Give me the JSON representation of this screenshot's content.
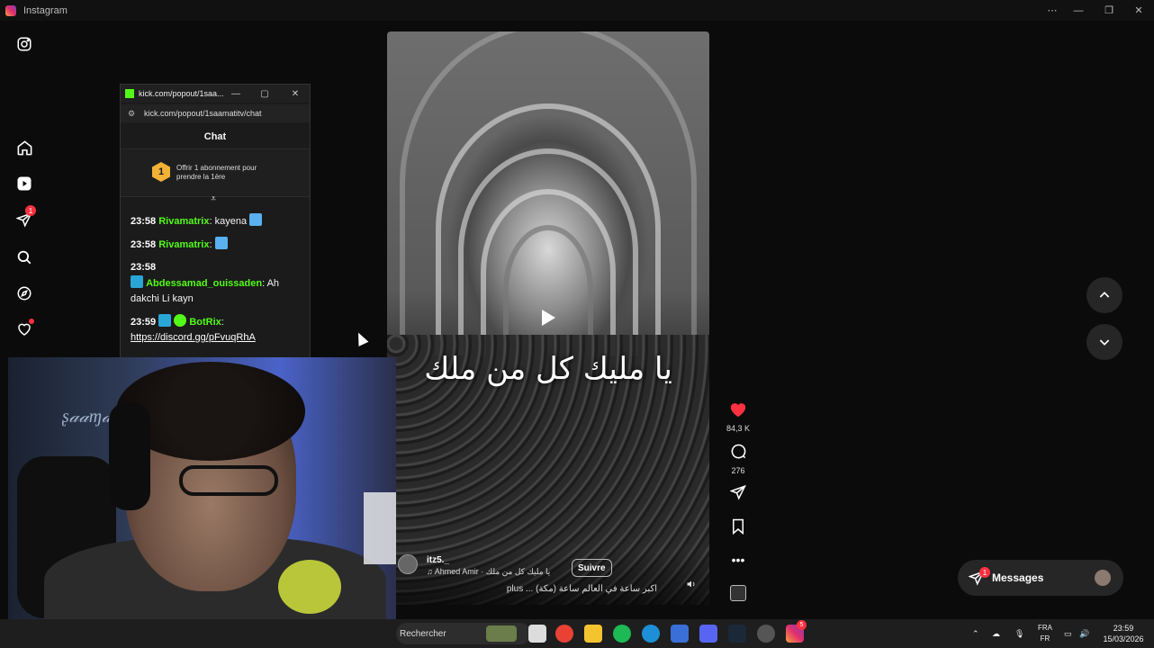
{
  "window": {
    "title": "Instagram",
    "controls": [
      "⋯",
      "—",
      "❐",
      "✕"
    ]
  },
  "sidebar": {
    "notifications_badge": "1"
  },
  "reel": {
    "overlay_text": "يا مليك كل من ملك",
    "author": "itz5._",
    "audio": "Ahmed Amir · يا مليك كل من ملك",
    "follow_label": "Suivre",
    "caption": "اكبر ساعة في العالم ساعة (مكة) ... plus",
    "likes": "84,3 K",
    "comments": "276"
  },
  "messages": {
    "label": "Messages",
    "badge": "1"
  },
  "kick_popup": {
    "tab_title": "kick.com/popout/1saa...",
    "url": "kick.com/popout/1saamatitv/chat",
    "chat_title": "Chat",
    "promo_coin": "1",
    "promo_text_line1": "Offrir 1 abonnement pour",
    "promo_text_line2": "prendre la 1ère",
    "messages": [
      {
        "time": "23:58",
        "user": "Rivamatrix",
        "text": "kayena",
        "color": "#53fc18"
      },
      {
        "time": "23:58",
        "user": "Rivamatrix",
        "text": "",
        "color": "#53fc18"
      },
      {
        "time": "23:58",
        "user": "Abdessamad_ouissaden",
        "text": "Ah dakchi Li kayn",
        "color": "#53fc18"
      },
      {
        "time": "23:59",
        "user": "BotRix",
        "text": "https://discord.gg/pFvuqRhA",
        "color": "#53fc18"
      }
    ]
  },
  "taskbar": {
    "search_placeholder": "Rechercher",
    "lang_line1": "FRA",
    "lang_line2": "FR",
    "time": "23:59",
    "date": "15/03/2026",
    "instagram_badge": "5"
  },
  "colors": {
    "kick_green": "#53fc18",
    "badge_red": "#ff3040",
    "like_red": "#ff3040"
  }
}
